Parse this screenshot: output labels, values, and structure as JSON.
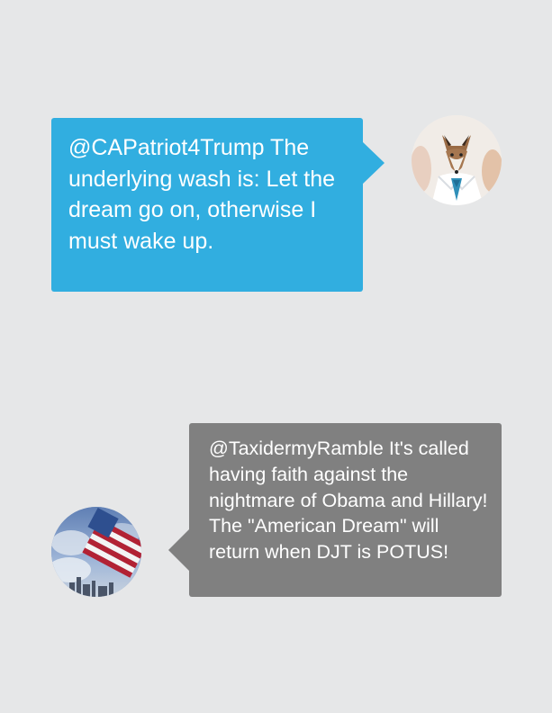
{
  "messages": [
    {
      "sender": "right",
      "avatar_icon": "fox-doctor-avatar-icon",
      "text": "@CAPatriot4Trump The underlying wash is: Let the dream go on, otherwise I must wake up.",
      "color": "#31aee0"
    },
    {
      "sender": "left",
      "avatar_icon": "american-flag-avatar-icon",
      "text": "@TaxidermyRamble It's called having faith against the nightmare of Obama and Hillary! The \"American Dream\" will return when DJT is POTUS!",
      "color": "#808080"
    }
  ],
  "background_color": "#e6e7e8"
}
